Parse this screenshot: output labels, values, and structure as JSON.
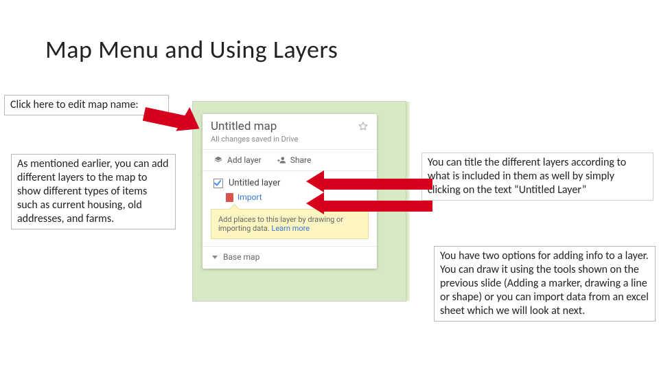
{
  "heading": "Map Menu and Using Layers",
  "callouts": {
    "top_left": "Click here to edit map name:",
    "mid_left": "As mentioned earlier, you can add different layers to the map to show different types of items such as current housing, old addresses, and farms.",
    "top_right": "You can title the different layers according to what is included in them as well by simply clicking on the text “Untitled Layer”",
    "bot_right": "You have two options for adding info to a layer. You can draw it using the tools shown on the previous slide (Adding a marker, drawing a line or shape) or you can import data from an excel sheet which we will look at next."
  },
  "panel": {
    "title": "Untitled map",
    "saved": "All changes saved in Drive",
    "add_layer": "Add layer",
    "share": "Share",
    "layer_name": "Untitled layer",
    "import": "Import",
    "hint": "Add places to this layer by drawing or importing data. ",
    "hint_link": "Learn more",
    "base": "Base map"
  }
}
